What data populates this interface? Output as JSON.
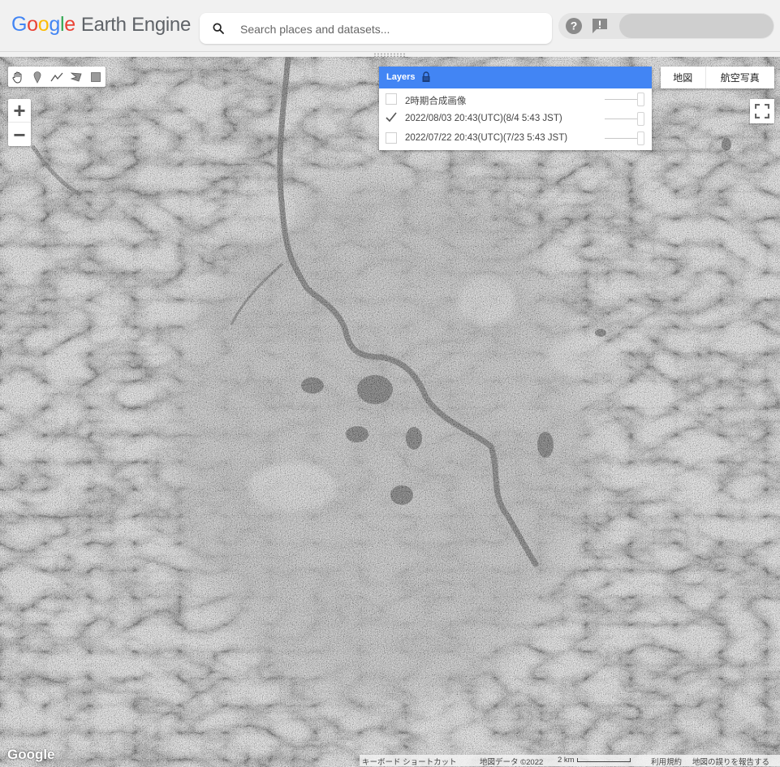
{
  "header": {
    "logo_google": [
      "G",
      "o",
      "o",
      "g",
      "l",
      "e"
    ],
    "logo_product": "Earth Engine",
    "search_placeholder": "Search places and datasets...",
    "icons": [
      "search-icon",
      "help-icon",
      "feedback-icon"
    ]
  },
  "map": {
    "draw_tools": [
      "hand-pan-icon",
      "marker-icon",
      "polyline-icon",
      "polygon-icon",
      "rectangle-icon"
    ],
    "zoom_in": "+",
    "zoom_out": "−",
    "layers": {
      "title": "Layers",
      "items": [
        {
          "name": "2時期合成画像",
          "checked": false
        },
        {
          "name": "2022/08/03 20:43(UTC)(8/4 5:43 JST)",
          "checked": true
        },
        {
          "name": "2022/07/22 20:43(UTC)(7/23 5:43 JST)",
          "checked": false
        }
      ]
    },
    "map_types": [
      "地図",
      "航空写真"
    ],
    "google_mark": "Google",
    "attribution": {
      "shortcuts": "キーボード ショートカット",
      "map_data": "地図データ ©2022",
      "scale": "2 km",
      "terms": "利用規約",
      "report": "地図の誤りを報告する"
    }
  },
  "colors": {
    "layers_header": "#4285f4",
    "header_bg": "#f1f1f1"
  }
}
